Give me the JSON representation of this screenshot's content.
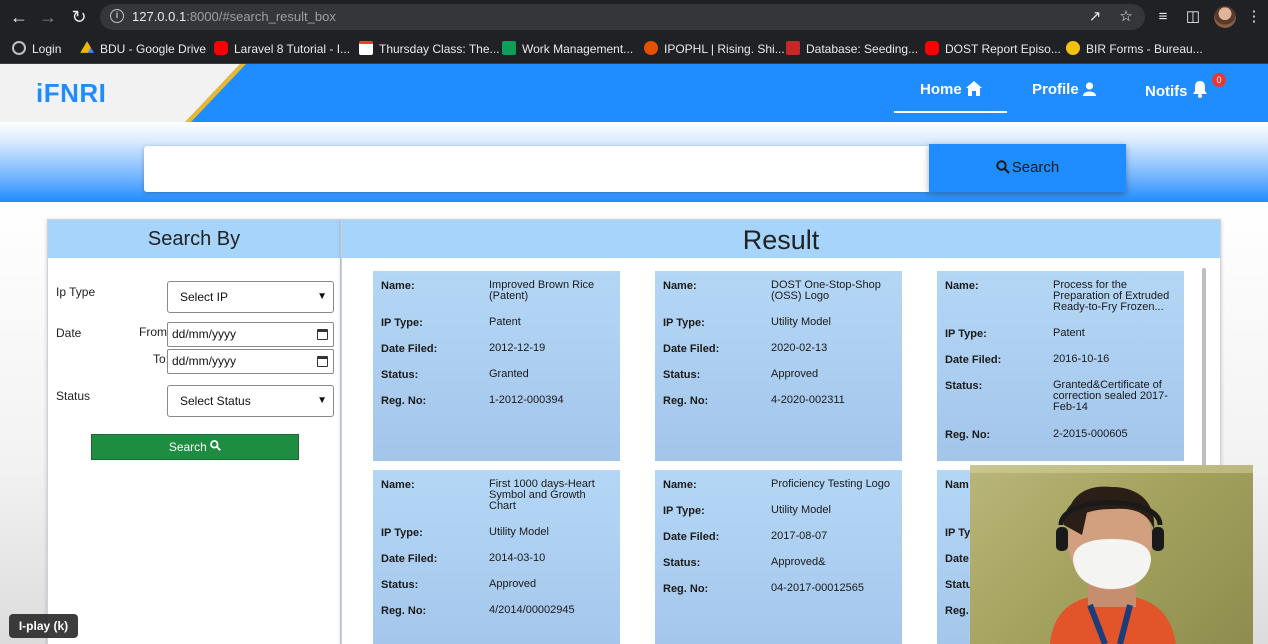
{
  "browser": {
    "url_host": "127.0.0.1",
    "url_rest": ":8000/#search_result_box",
    "bookmarks": [
      {
        "label": "Login",
        "icon": "globe-icon",
        "color": "#bdc1c6"
      },
      {
        "label": "BDU - Google Drive",
        "icon": "google-drive-icon",
        "color": "#f4b400"
      },
      {
        "label": "Laravel 8 Tutorial - I...",
        "icon": "youtube-icon",
        "color": "#ff0000"
      },
      {
        "label": "Thursday Class: The...",
        "icon": "gmail-icon",
        "color": "#ea4335"
      },
      {
        "label": "Work Management...",
        "icon": "sheet-icon",
        "color": "#0f9d58"
      },
      {
        "label": "IPOPHL | Rising. Shi...",
        "icon": "ipophl-icon",
        "color": "#e65100"
      },
      {
        "label": "Database: Seeding...",
        "icon": "laravel-icon",
        "color": "#c62828"
      },
      {
        "label": "DOST Report Episo...",
        "icon": "youtube-icon",
        "color": "#ff0000"
      },
      {
        "label": "BIR Forms - Bureau...",
        "icon": "bir-icon",
        "color": "#f4c20d"
      }
    ]
  },
  "header": {
    "logo": "iFNRI",
    "nav": {
      "home": "Home",
      "profile": "Profile",
      "notifs": "Notifs",
      "notif_count": "0"
    }
  },
  "search": {
    "input_value": "",
    "button_label": "Search"
  },
  "filters": {
    "title": "Search By",
    "ip_type_label": "Ip Type",
    "ip_type_value": "Select IP",
    "date_label": "Date",
    "from_label": "From:",
    "to_label": "To:",
    "from_value": "dd/mm/yyyy",
    "to_value": "dd/mm/yyyy",
    "status_label": "Status",
    "status_value": "Select Status",
    "search_label": "Search"
  },
  "results": {
    "title": "Result",
    "keys": {
      "name": "Name:",
      "ip_type": "IP Type:",
      "date_filed": "Date Filed:",
      "status": "Status:",
      "reg_no": "Reg. No:"
    },
    "cards": [
      {
        "name": "Improved Brown Rice (Patent)",
        "ip_type": "Patent",
        "date_filed": "2012-12-19",
        "status": "Granted",
        "reg_no": "1-2012-000394"
      },
      {
        "name": "DOST One-Stop-Shop (OSS) Logo",
        "ip_type": "Utility Model",
        "date_filed": "2020-02-13",
        "status": "Approved",
        "reg_no": "4-2020-002311"
      },
      {
        "name": "Process for the Preparation of Extruded Ready-to-Fry Frozen...",
        "ip_type": "Patent",
        "date_filed": "2016-10-16",
        "status": "Granted&Certificate of correction sealed 2017-Feb-14",
        "reg_no": "2-2015-000605"
      },
      {
        "name": "First 1000 days-Heart Symbol and Growth Chart",
        "ip_type": "Utility Model",
        "date_filed": "2014-03-10",
        "status": "Approved",
        "reg_no": "4/2014/00002945"
      },
      {
        "name": "Proficiency Testing Logo",
        "ip_type": "Utility Model",
        "date_filed": "2017-08-07",
        "status": "Approved&",
        "reg_no": "04-2017-00012565"
      },
      {
        "partial_name_key": "Nam",
        "partial_ip_key": "IP Ty",
        "partial_date_key": "Date",
        "partial_status_key": "Statu",
        "partial_reg_key": "Reg."
      }
    ]
  },
  "overlay": {
    "play_tooltip": "I-play (k)"
  }
}
